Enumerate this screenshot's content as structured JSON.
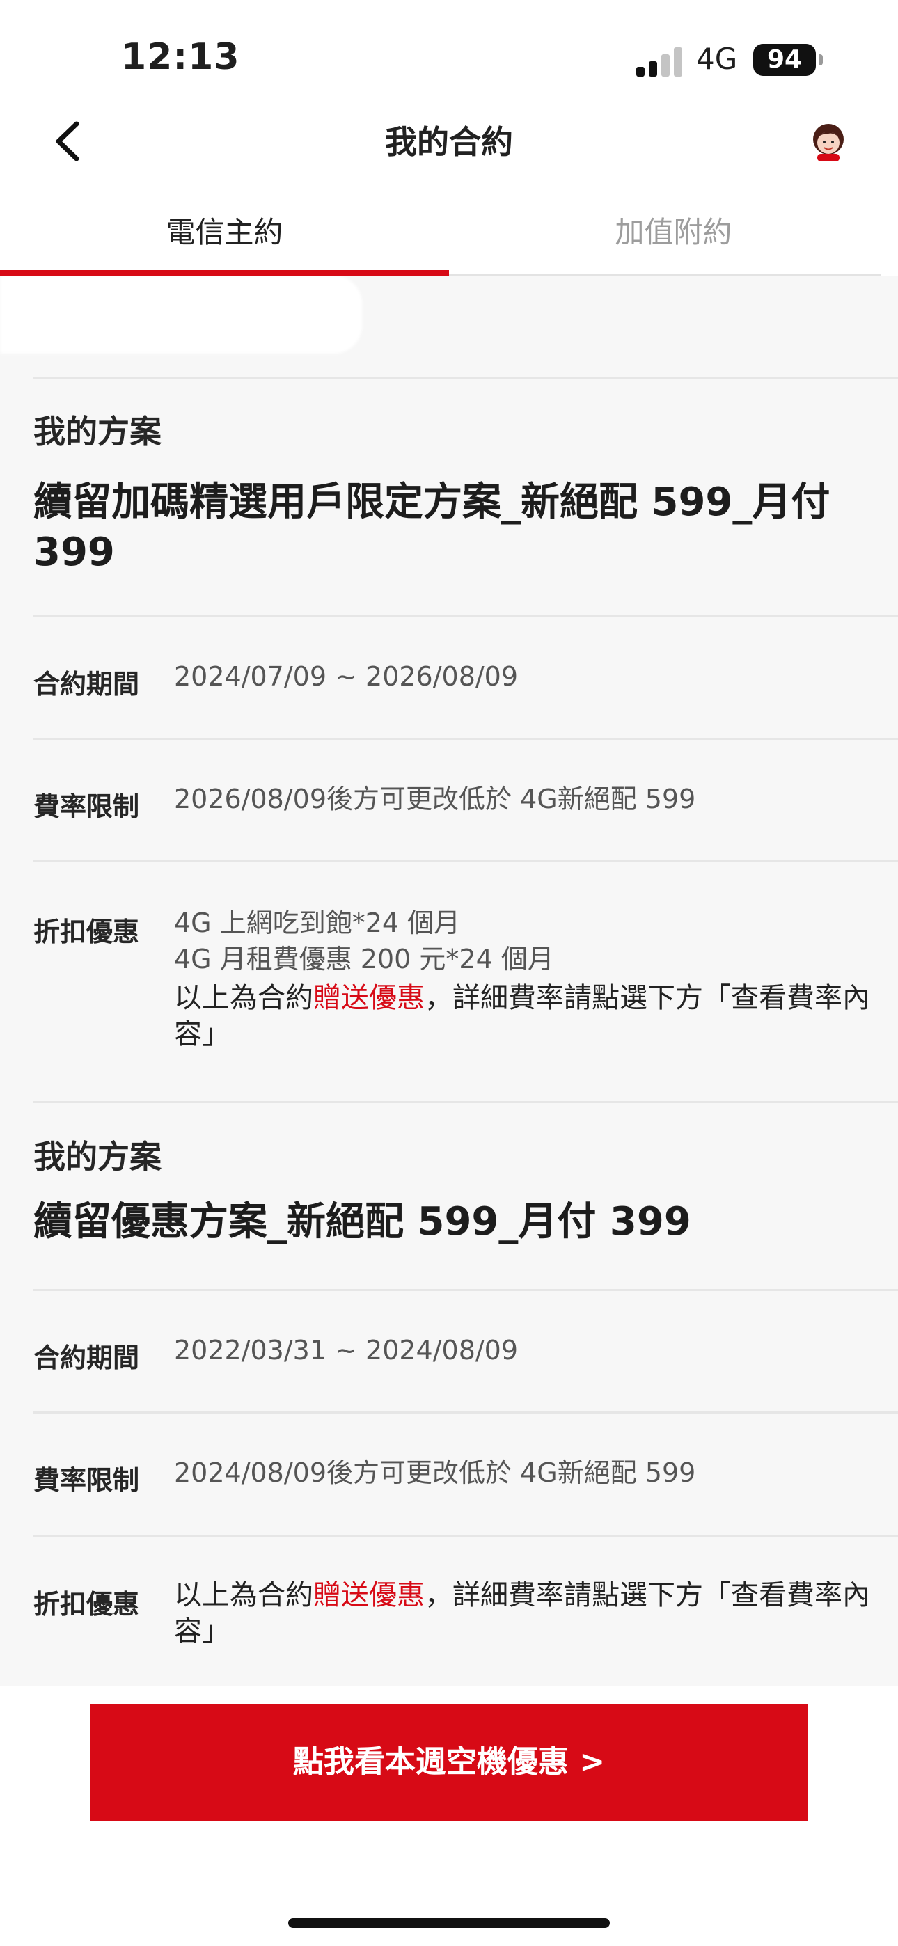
{
  "status_bar": {
    "time": "12:13",
    "network": "4G",
    "battery": "94"
  },
  "header": {
    "title": "我的合約"
  },
  "tabs": [
    {
      "label": "電信主約",
      "active": true
    },
    {
      "label": "加值附約",
      "active": false
    }
  ],
  "plans": [
    {
      "section_label": "我的方案",
      "name": "續留加碼精選用戶限定方案_新絕配 599_月付 399",
      "period_label": "合約期間",
      "period": "2024/07/09 ~ 2026/08/09",
      "rate_label": "費率限制",
      "rate": "2026/08/09後方可更改低於 4G新絕配 599",
      "discount_label": "折扣優惠",
      "discount_lines": [
        "4G 上網吃到飽*24 個月",
        "4G 月租費優惠 200 元*24 個月"
      ],
      "note_prefix": "以上為合約",
      "note_highlight": "贈送優惠",
      "note_suffix": "，詳細費率請點選下方「查看費率內容」"
    },
    {
      "section_label": "我的方案",
      "name": "續留優惠方案_新絕配 599_月付 399",
      "period_label": "合約期間",
      "period": "2022/03/31 ~ 2024/08/09",
      "rate_label": "費率限制",
      "rate": "2024/08/09後方可更改低於 4G新絕配 599",
      "discount_label": "折扣優惠",
      "note_prefix": "以上為合約",
      "note_highlight": "贈送優惠",
      "note_suffix": "，詳細費率請點選下方「查看費率內容」"
    }
  ],
  "cta": {
    "label": "點我看本週空機優惠 >"
  },
  "colors": {
    "brand_red": "#d70a16"
  }
}
